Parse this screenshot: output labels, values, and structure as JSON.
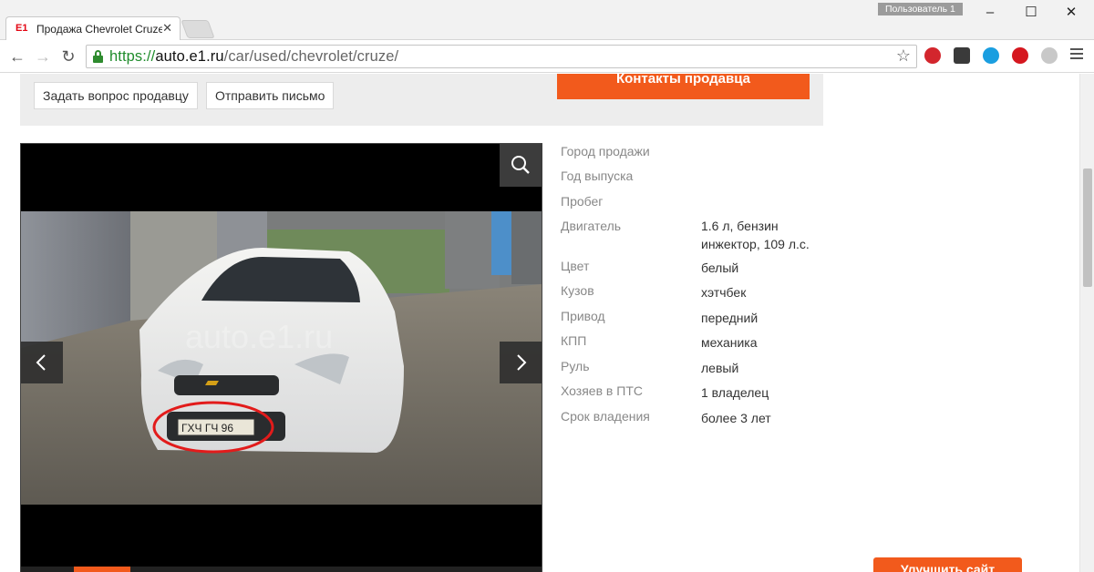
{
  "browser": {
    "tab": {
      "logo": "E1",
      "title": "Продажа Chevrolet Cruze"
    },
    "user_badge": "Пользователь 1",
    "address": {
      "scheme": "https://",
      "host": "auto.e1.ru",
      "path": "/car/used/chevrolet/cruze/"
    },
    "extensions": [
      "adblock-plus-icon",
      "honey-icon",
      "skype-icon",
      "opera-icon",
      "globe-icon"
    ]
  },
  "contact": {
    "ask_seller_label": "Задать вопрос продавцу",
    "send_letter_label": "Отправить письмо",
    "seller_contacts_label": "Контакты продавца"
  },
  "gallery": {
    "watermark": "auto.e1.ru",
    "plate_text": "ГХЧ ГЧ 96"
  },
  "specs": [
    {
      "label": "Город продажи",
      "value": ""
    },
    {
      "label": "Год выпуска",
      "value": ""
    },
    {
      "label": "Пробег",
      "value": ""
    },
    {
      "label": "Двигатель",
      "value": "1.6 л, бензин инжектор, 109 л.с."
    },
    {
      "label": "Цвет",
      "value": "белый"
    },
    {
      "label": "Кузов",
      "value": "хэтчбек"
    },
    {
      "label": "Привод",
      "value": "передний"
    },
    {
      "label": "КПП",
      "value": "механика"
    },
    {
      "label": "Руль",
      "value": "левый"
    },
    {
      "label": "Хозяев в ПТС",
      "value": "1 владелец"
    },
    {
      "label": "Срок владения",
      "value": "более 3 лет"
    }
  ],
  "feedback": {
    "improve_label": "Улучшить сайт"
  },
  "colors": {
    "accent": "#f25a1c",
    "panel": "#ededed"
  }
}
